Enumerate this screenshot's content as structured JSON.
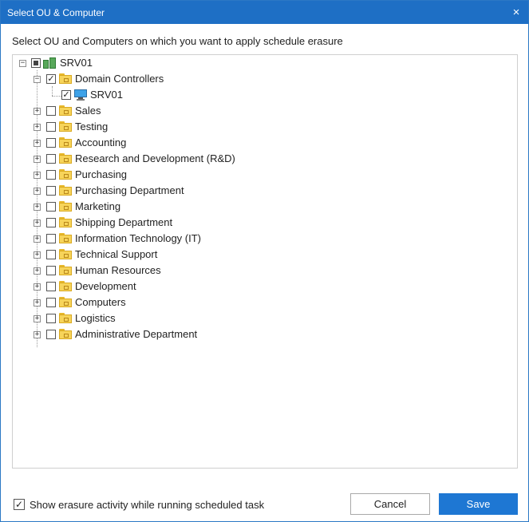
{
  "window": {
    "title": "Select OU & Computer",
    "close_glyph": "×"
  },
  "instruction": "Select OU and Computers on which you want to apply schedule erasure",
  "tree": {
    "root": {
      "label": "SRV01",
      "expand_glyph": "−",
      "state": "partial",
      "icon": "server-icon"
    },
    "domain_controllers": {
      "label": "Domain Controllers",
      "expand_glyph": "−",
      "checked": "✓",
      "icon": "folder-icon"
    },
    "dc_computer": {
      "label": "SRV01",
      "checked": "✓",
      "icon": "computer-icon"
    },
    "ous": [
      {
        "label": "Sales"
      },
      {
        "label": "Testing"
      },
      {
        "label": "Accounting"
      },
      {
        "label": "Research and Development (R&D)"
      },
      {
        "label": "Purchasing"
      },
      {
        "label": "Purchasing Department"
      },
      {
        "label": "Marketing"
      },
      {
        "label": "Shipping Department"
      },
      {
        "label": "Information Technology (IT)"
      },
      {
        "label": "Technical Support"
      },
      {
        "label": "Human Resources"
      },
      {
        "label": "Development"
      },
      {
        "label": "Computers"
      },
      {
        "label": "Logistics"
      },
      {
        "label": "Administrative Department"
      }
    ],
    "collapsed_glyph": "+"
  },
  "footer": {
    "show_activity_label": "Show erasure activity while running scheduled task",
    "show_activity_checked": "✓",
    "cancel_label": "Cancel",
    "save_label": "Save"
  },
  "colors": {
    "title_bar": "#1e6fc5",
    "primary_button": "#1e77d3",
    "folder": "#f7d45a"
  }
}
